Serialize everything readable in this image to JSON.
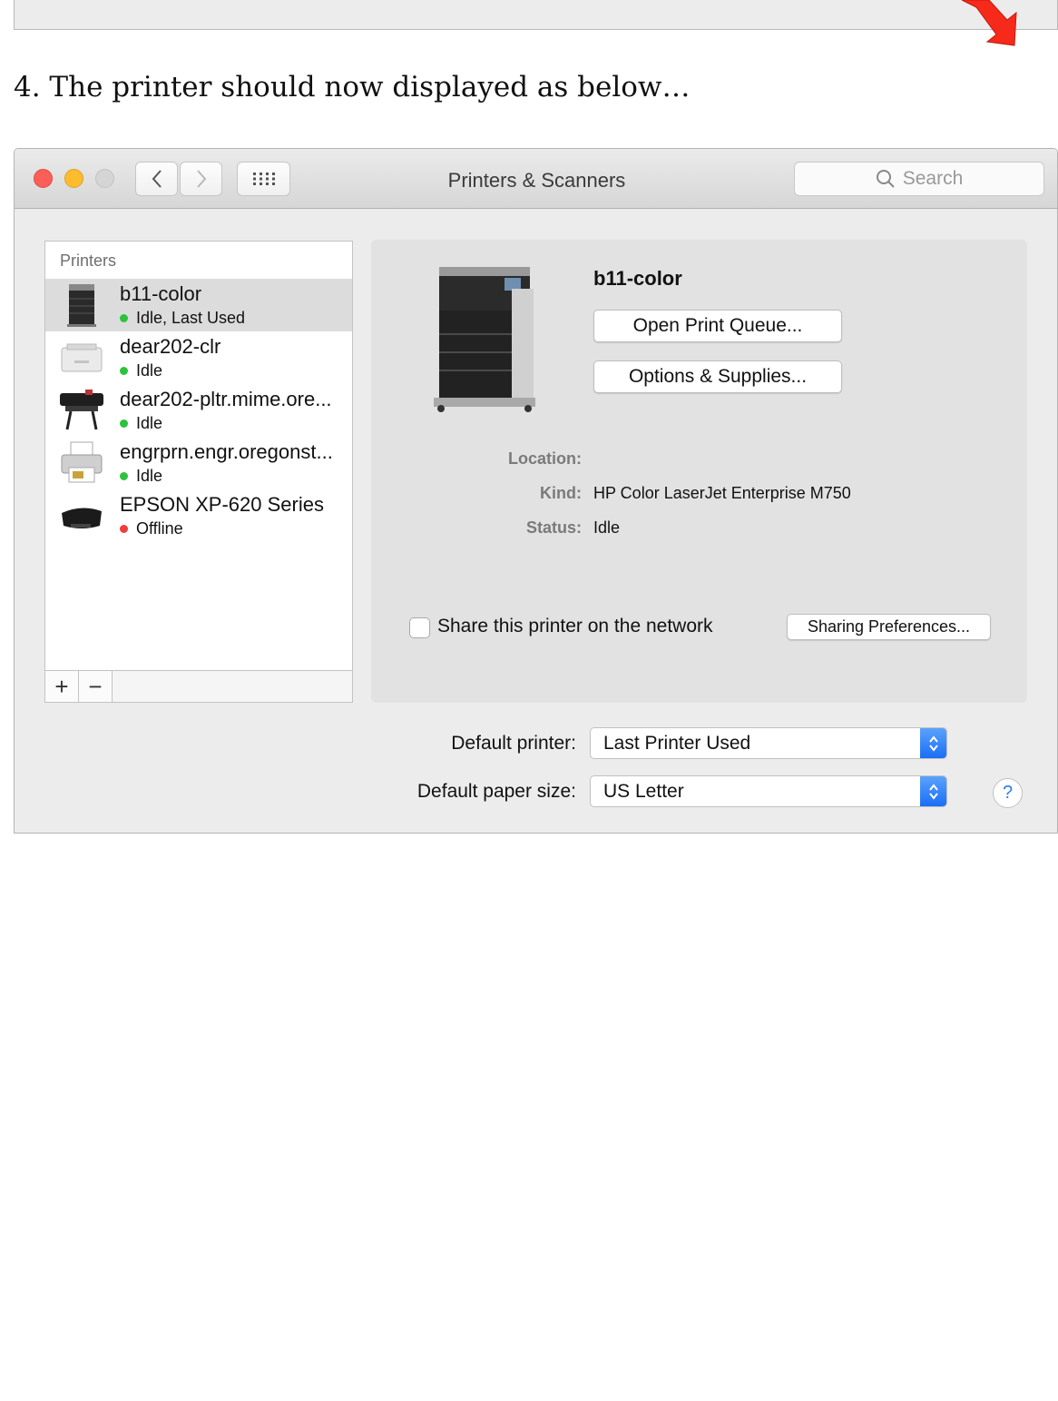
{
  "step_text": "4. The printer should now displayed as below…",
  "window": {
    "title": "Printers & Scanners",
    "search_placeholder": "Search"
  },
  "printer_list": {
    "header": "Printers",
    "items": [
      {
        "name": "b11-color",
        "status": "Idle, Last Used",
        "status_color": "#2bc33b",
        "icon": "laser-printer-large-icon",
        "selected": true
      },
      {
        "name": "dear202-clr",
        "status": "Idle",
        "status_color": "#2bc33b",
        "icon": "desktop-printer-icon",
        "selected": false
      },
      {
        "name": "dear202-pltr.mime.ore...",
        "status": "Idle",
        "status_color": "#2bc33b",
        "icon": "plotter-icon",
        "selected": false
      },
      {
        "name": "engrprn.engr.oregonst...",
        "status": "Idle",
        "status_color": "#2bc33b",
        "icon": "generic-printer-icon",
        "selected": false
      },
      {
        "name": "EPSON XP-620 Series",
        "status": "Offline",
        "status_color": "#f03c3c",
        "icon": "inkjet-printer-icon",
        "selected": false
      }
    ],
    "add_label": "+",
    "remove_label": "−"
  },
  "detail": {
    "name": "b11-color",
    "open_queue_label": "Open Print Queue...",
    "options_label": "Options & Supplies...",
    "location_label": "Location:",
    "kind_label": "Kind:",
    "kind_value": "HP Color LaserJet Enterprise M750",
    "status_label": "Status:",
    "status_value": "Idle",
    "share_label": "Share this printer on the network",
    "share_checked": false,
    "sharing_prefs_label": "Sharing Preferences..."
  },
  "settings": {
    "default_printer_label": "Default printer:",
    "default_printer_value": "Last Printer Used",
    "default_paper_label": "Default paper size:",
    "default_paper_value": "US Letter",
    "help_label": "?"
  },
  "colors": {
    "accent": "#1a6ef5",
    "arrow": "#f52a1a"
  }
}
